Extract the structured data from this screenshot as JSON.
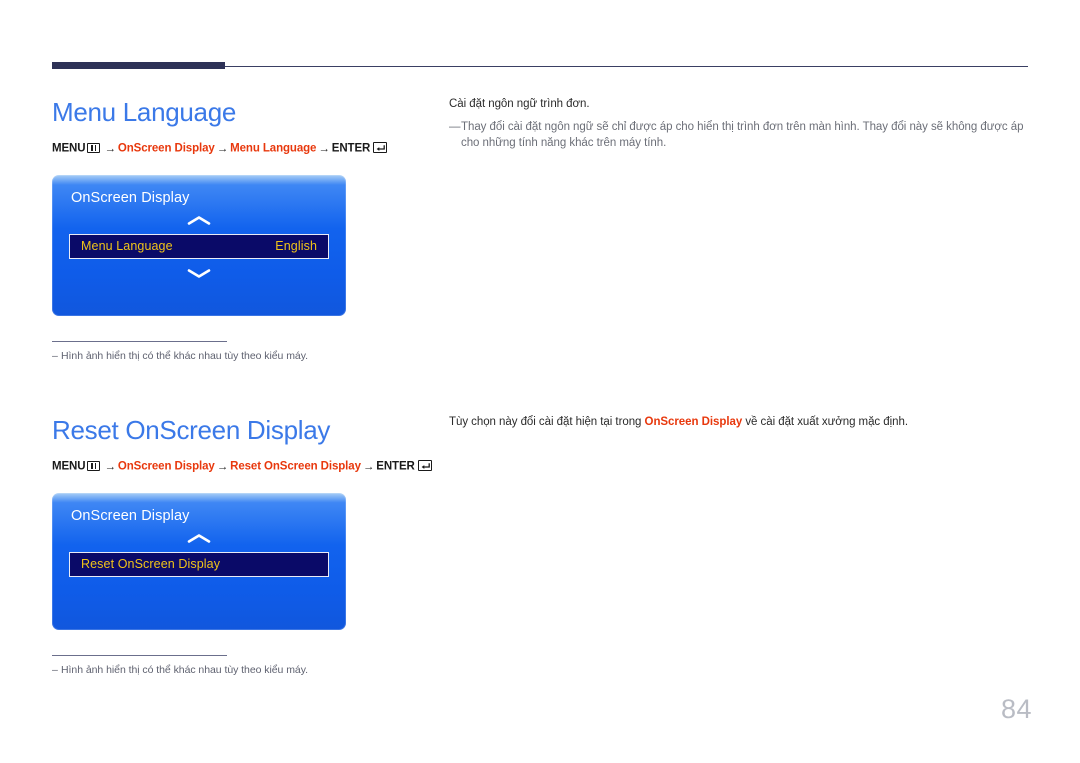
{
  "document": {
    "page_number": "84",
    "accent_blue": "#3b79e8",
    "accent_red": "#e8380d",
    "osd_highlight_text": "#f0c419",
    "osd_highlight_bg": "#0a0a68"
  },
  "sections": [
    {
      "title": "Menu Language",
      "breadcrumb": {
        "menu_label": "MENU",
        "menu_icon": "menu-grid-icon",
        "arrow": "→",
        "path": [
          "OnScreen Display",
          "Menu Language"
        ],
        "enter_label": "ENTER",
        "enter_icon": "enter-return-icon"
      },
      "osd": {
        "header": "OnScreen Display",
        "up_chevron": "chevron-up-icon",
        "down_chevron": "chevron-down-icon",
        "has_down_chevron": true,
        "row": {
          "label": "Menu Language",
          "value": "English"
        }
      },
      "footnote": "Hình ảnh hiển thị có thể khác nhau tùy theo kiểu máy.",
      "footnote_dash": "‒",
      "body": {
        "lead": "Cài đặt ngôn ngữ trình đơn.",
        "note_marker": "—",
        "note": "Thay đổi cài đặt ngôn ngữ sẽ chỉ được áp cho hiển thị trình đơn trên màn hình. Thay đổi này sẽ không được áp cho những tính năng khác trên máy tính."
      }
    },
    {
      "title": "Reset OnScreen Display",
      "breadcrumb": {
        "menu_label": "MENU",
        "menu_icon": "menu-grid-icon",
        "arrow": "→",
        "path": [
          "OnScreen Display",
          "Reset OnScreen Display"
        ],
        "enter_label": "ENTER",
        "enter_icon": "enter-return-icon"
      },
      "osd": {
        "header": "OnScreen Display",
        "up_chevron": "chevron-up-icon",
        "has_down_chevron": false,
        "row": {
          "label": "Reset OnScreen Display",
          "value": ""
        }
      },
      "footnote": "Hình ảnh hiển thị có thể khác nhau tùy theo kiểu máy.",
      "footnote_dash": "‒",
      "body": {
        "lead_before": "Tùy chọn này đổi cài đặt hiện tại trong ",
        "lead_highlight": "OnScreen Display",
        "lead_after": " về cài đặt xuất xưởng mặc định."
      }
    }
  ]
}
